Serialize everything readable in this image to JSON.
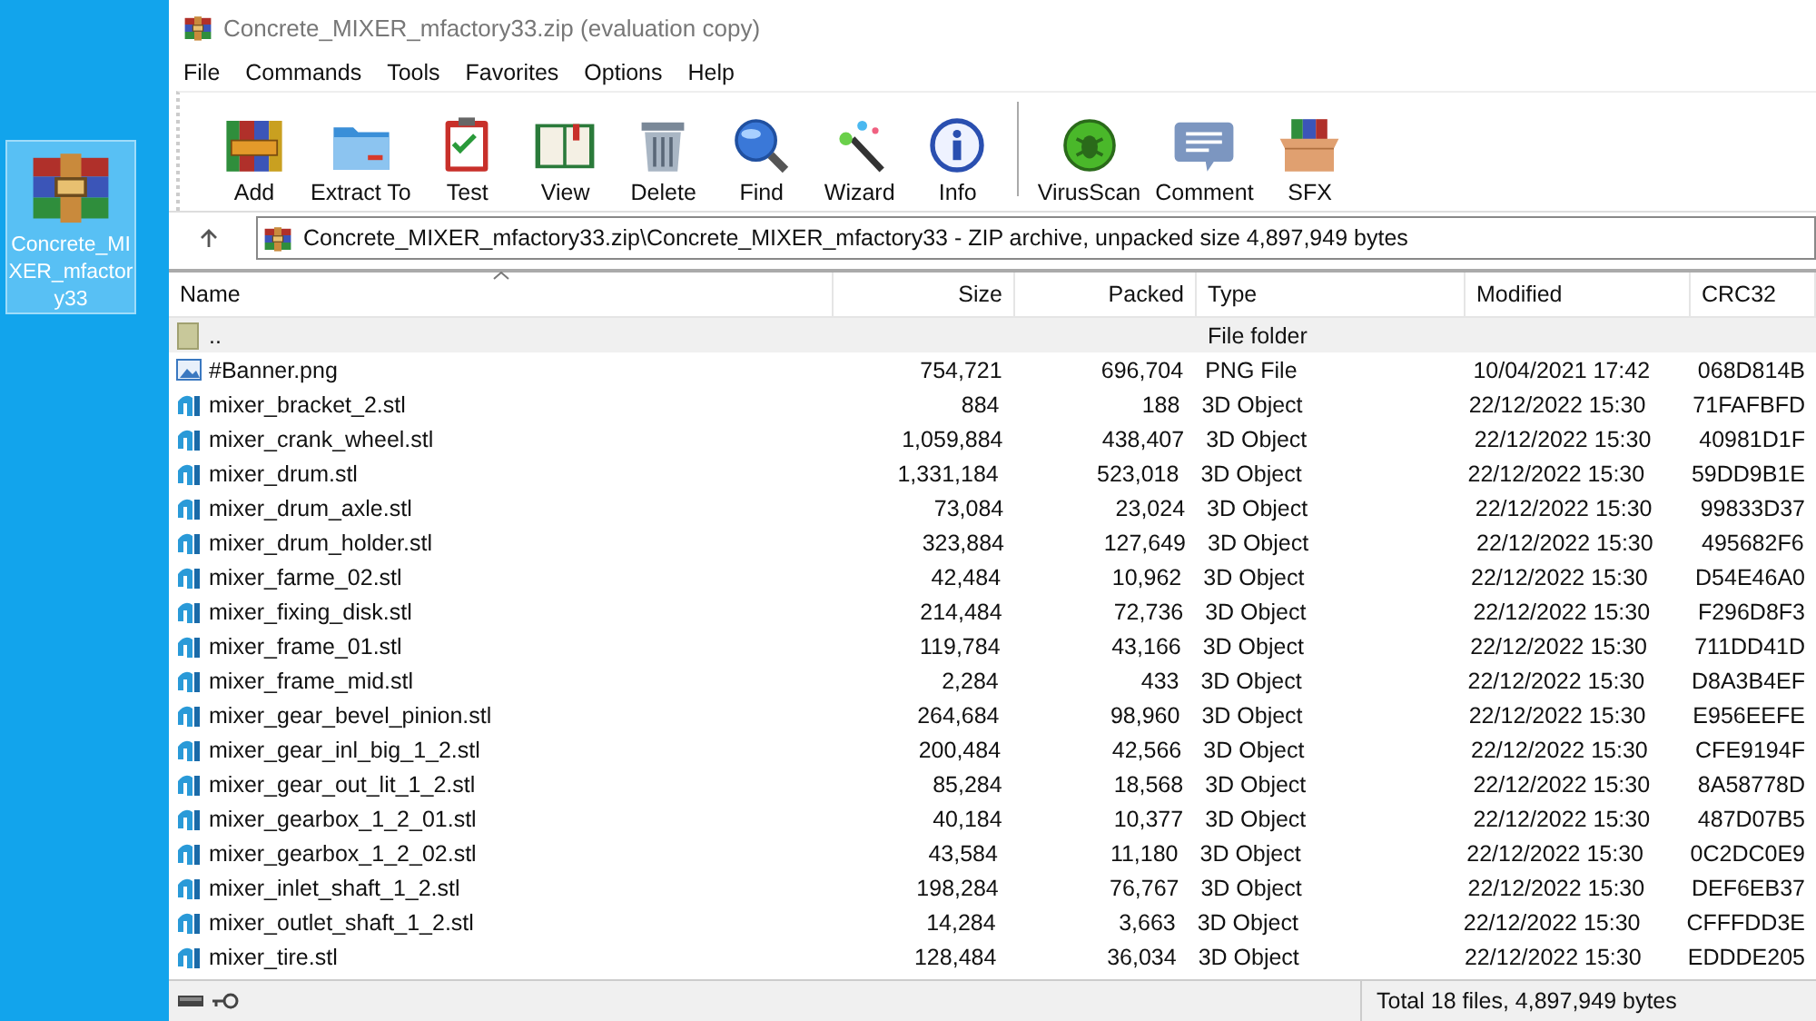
{
  "desktop_icon": {
    "label": "Concrete_MIXER_mfactory33",
    "selected": true
  },
  "window": {
    "title": "Concrete_MIXER_mfactory33.zip (evaluation copy)"
  },
  "menu": [
    "File",
    "Commands",
    "Tools",
    "Favorites",
    "Options",
    "Help"
  ],
  "toolbar": [
    {
      "label": "Add",
      "kind": "add"
    },
    {
      "label": "Extract To",
      "kind": "extract"
    },
    {
      "label": "Test",
      "kind": "test"
    },
    {
      "label": "View",
      "kind": "view"
    },
    {
      "label": "Delete",
      "kind": "delete"
    },
    {
      "label": "Find",
      "kind": "find"
    },
    {
      "label": "Wizard",
      "kind": "wizard"
    },
    {
      "label": "Info",
      "kind": "info"
    },
    {
      "label": "VirusScan",
      "kind": "virus"
    },
    {
      "label": "Comment",
      "kind": "comment"
    },
    {
      "label": "SFX",
      "kind": "sfx"
    }
  ],
  "address": {
    "path": "Concrete_MIXER_mfactory33.zip\\Concrete_MIXER_mfactory33 - ZIP archive, unpacked size 4,897,949 bytes"
  },
  "table": {
    "columns": [
      {
        "label": "Name",
        "sorted": true
      },
      {
        "label": "Size",
        "sorted": false
      },
      {
        "label": "Packed",
        "sorted": false
      },
      {
        "label": "Type",
        "sorted": false
      },
      {
        "label": "Modified",
        "sorted": false
      },
      {
        "label": "CRC32",
        "sorted": false
      }
    ],
    "rows": [
      {
        "kind": "folder",
        "selected": true,
        "name": "..",
        "size": "",
        "packed": "",
        "type": "File folder",
        "modified": "",
        "crc": ""
      },
      {
        "kind": "image",
        "selected": false,
        "name": "#Banner.png",
        "size": "754,721",
        "packed": "696,704",
        "type": "PNG File",
        "modified": "10/04/2021 17:42",
        "crc": "068D814B"
      },
      {
        "kind": "model",
        "selected": false,
        "name": "mixer_bracket_2.stl",
        "size": "884",
        "packed": "188",
        "type": "3D Object",
        "modified": "22/12/2022 15:30",
        "crc": "71FAFBFD"
      },
      {
        "kind": "model",
        "selected": false,
        "name": "mixer_crank_wheel.stl",
        "size": "1,059,884",
        "packed": "438,407",
        "type": "3D Object",
        "modified": "22/12/2022 15:30",
        "crc": "40981D1F"
      },
      {
        "kind": "model",
        "selected": false,
        "name": "mixer_drum.stl",
        "size": "1,331,184",
        "packed": "523,018",
        "type": "3D Object",
        "modified": "22/12/2022 15:30",
        "crc": "59DD9B1E"
      },
      {
        "kind": "model",
        "selected": false,
        "name": "mixer_drum_axle.stl",
        "size": "73,084",
        "packed": "23,024",
        "type": "3D Object",
        "modified": "22/12/2022 15:30",
        "crc": "99833D37"
      },
      {
        "kind": "model",
        "selected": false,
        "name": "mixer_drum_holder.stl",
        "size": "323,884",
        "packed": "127,649",
        "type": "3D Object",
        "modified": "22/12/2022 15:30",
        "crc": "495682F6"
      },
      {
        "kind": "model",
        "selected": false,
        "name": "mixer_farme_02.stl",
        "size": "42,484",
        "packed": "10,962",
        "type": "3D Object",
        "modified": "22/12/2022 15:30",
        "crc": "D54E46A0"
      },
      {
        "kind": "model",
        "selected": false,
        "name": "mixer_fixing_disk.stl",
        "size": "214,484",
        "packed": "72,736",
        "type": "3D Object",
        "modified": "22/12/2022 15:30",
        "crc": "F296D8F3"
      },
      {
        "kind": "model",
        "selected": false,
        "name": "mixer_frame_01.stl",
        "size": "119,784",
        "packed": "43,166",
        "type": "3D Object",
        "modified": "22/12/2022 15:30",
        "crc": "711DD41D"
      },
      {
        "kind": "model",
        "selected": false,
        "name": "mixer_frame_mid.stl",
        "size": "2,284",
        "packed": "433",
        "type": "3D Object",
        "modified": "22/12/2022 15:30",
        "crc": "D8A3B4EF"
      },
      {
        "kind": "model",
        "selected": false,
        "name": "mixer_gear_bevel_pinion.stl",
        "size": "264,684",
        "packed": "98,960",
        "type": "3D Object",
        "modified": "22/12/2022 15:30",
        "crc": "E956EEFE"
      },
      {
        "kind": "model",
        "selected": false,
        "name": "mixer_gear_inl_big_1_2.stl",
        "size": "200,484",
        "packed": "42,566",
        "type": "3D Object",
        "modified": "22/12/2022 15:30",
        "crc": "CFE9194F"
      },
      {
        "kind": "model",
        "selected": false,
        "name": "mixer_gear_out_lit_1_2.stl",
        "size": "85,284",
        "packed": "18,568",
        "type": "3D Object",
        "modified": "22/12/2022 15:30",
        "crc": "8A58778D"
      },
      {
        "kind": "model",
        "selected": false,
        "name": "mixer_gearbox_1_2_01.stl",
        "size": "40,184",
        "packed": "10,377",
        "type": "3D Object",
        "modified": "22/12/2022 15:30",
        "crc": "487D07B5"
      },
      {
        "kind": "model",
        "selected": false,
        "name": "mixer_gearbox_1_2_02.stl",
        "size": "43,584",
        "packed": "11,180",
        "type": "3D Object",
        "modified": "22/12/2022 15:30",
        "crc": "0C2DC0E9"
      },
      {
        "kind": "model",
        "selected": false,
        "name": "mixer_inlet_shaft_1_2.stl",
        "size": "198,284",
        "packed": "76,767",
        "type": "3D Object",
        "modified": "22/12/2022 15:30",
        "crc": "DEF6EB37"
      },
      {
        "kind": "model",
        "selected": false,
        "name": "mixer_outlet_shaft_1_2.stl",
        "size": "14,284",
        "packed": "3,663",
        "type": "3D Object",
        "modified": "22/12/2022 15:30",
        "crc": "CFFFDD3E"
      },
      {
        "kind": "model",
        "selected": false,
        "name": "mixer_tire.stl",
        "size": "128,484",
        "packed": "36,034",
        "type": "3D Object",
        "modified": "22/12/2022 15:30",
        "crc": "EDDDE205"
      }
    ]
  },
  "status_bar": {
    "total": "Total 18 files, 4,897,949 bytes"
  }
}
